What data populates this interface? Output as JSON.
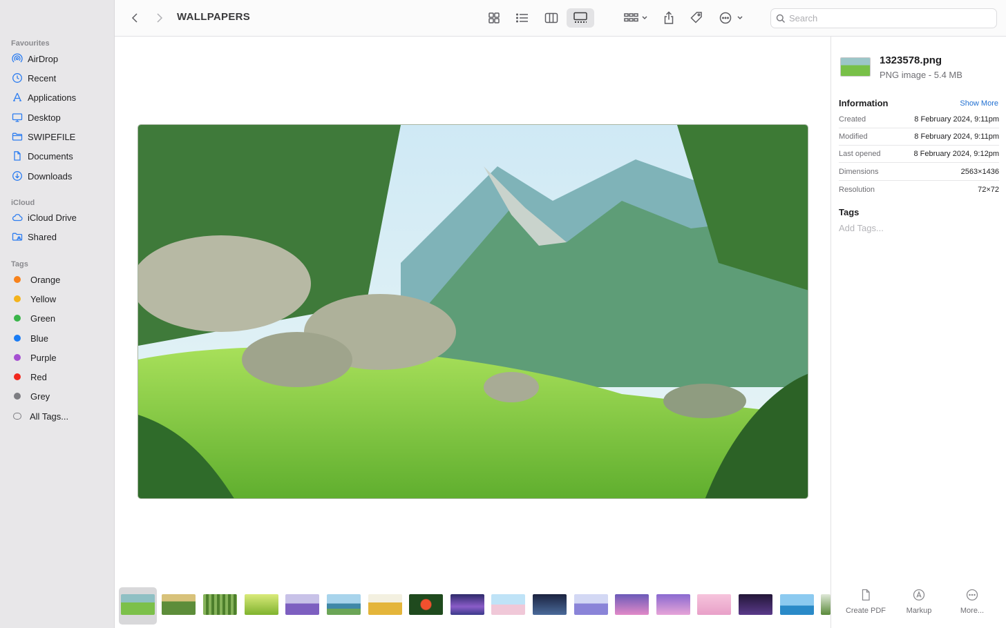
{
  "window": {
    "title": "WALLPAPERS"
  },
  "sidebar": {
    "favourites_label": "Favourites",
    "favourites": [
      {
        "label": "AirDrop",
        "icon": "airdrop-icon"
      },
      {
        "label": "Recent",
        "icon": "clock-icon"
      },
      {
        "label": "Applications",
        "icon": "applications-icon"
      },
      {
        "label": "Desktop",
        "icon": "desktop-icon"
      },
      {
        "label": "SWIPEFILE",
        "icon": "folder-icon"
      },
      {
        "label": "Documents",
        "icon": "document-icon"
      },
      {
        "label": "Downloads",
        "icon": "download-icon"
      }
    ],
    "icloud_label": "iCloud",
    "icloud": [
      {
        "label": "iCloud Drive",
        "icon": "cloud-icon"
      },
      {
        "label": "Shared",
        "icon": "shared-folder-icon"
      }
    ],
    "tags_label": "Tags",
    "tags": [
      {
        "label": "Orange",
        "color": "#f7821b"
      },
      {
        "label": "Yellow",
        "color": "#f4b31c"
      },
      {
        "label": "Green",
        "color": "#3ab54a"
      },
      {
        "label": "Blue",
        "color": "#1a7cf4"
      },
      {
        "label": "Purple",
        "color": "#a550d2"
      },
      {
        "label": "Red",
        "color": "#f2281e"
      },
      {
        "label": "Grey",
        "color": "#7d7d82"
      },
      {
        "label": "All Tags...",
        "color": ""
      }
    ]
  },
  "toolbar": {
    "search_placeholder": "Search"
  },
  "inspector": {
    "filename": "1323578.png",
    "kind": "PNG image - 5.4 MB",
    "information_label": "Information",
    "show_more": "Show More",
    "rows": [
      {
        "key": "Created",
        "value": "8 February 2024, 9:11pm"
      },
      {
        "key": "Modified",
        "value": "8 February 2024, 9:11pm"
      },
      {
        "key": "Last opened",
        "value": "8 February 2024, 9:12pm"
      },
      {
        "key": "Dimensions",
        "value": "2563×1436"
      },
      {
        "key": "Resolution",
        "value": "72×72"
      }
    ],
    "tags_label": "Tags",
    "add_tags": "Add Tags...",
    "actions": [
      {
        "label": "Create PDF",
        "icon": "document-icon"
      },
      {
        "label": "Markup",
        "icon": "markup-icon"
      },
      {
        "label": "More...",
        "icon": "ellipsis-circle-icon"
      }
    ]
  },
  "colors": {
    "accent": "#1f6fd1",
    "sidebar_bg": "#e8e7e9",
    "icon_blue": "#2b7cf0"
  }
}
